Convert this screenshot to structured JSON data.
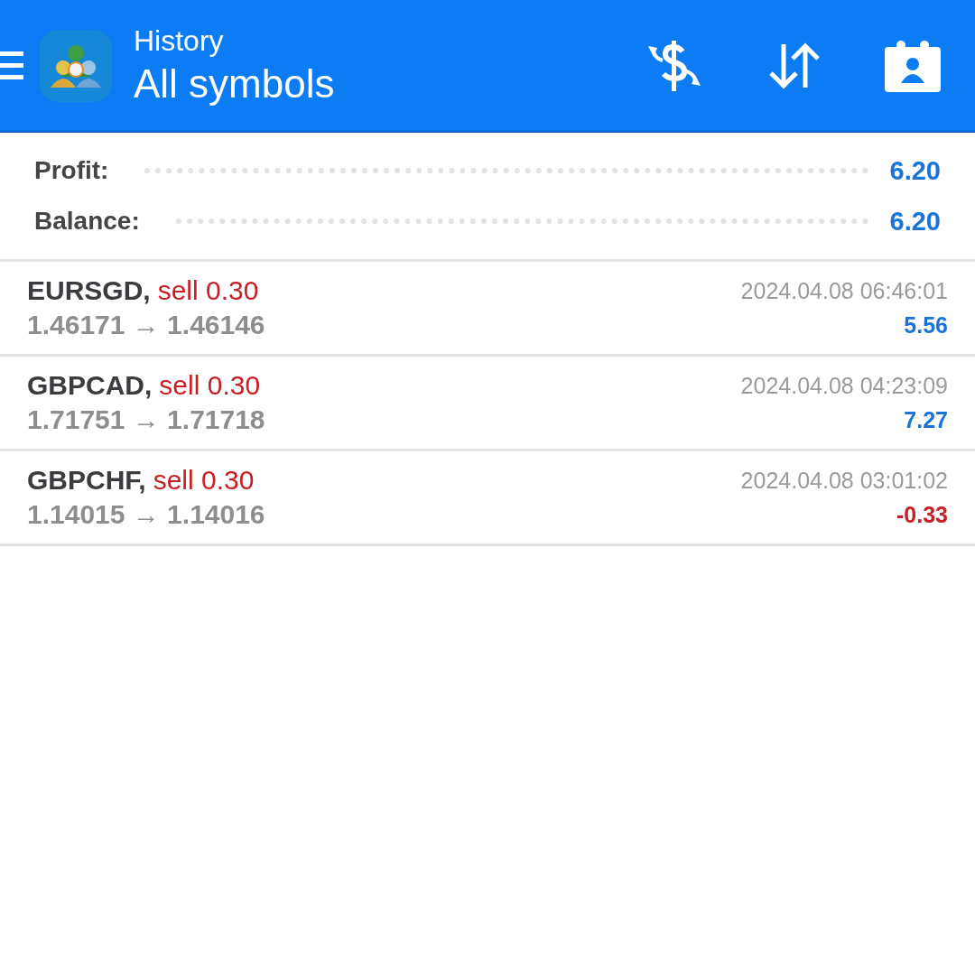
{
  "header": {
    "title": "History",
    "subtitle": "All symbols"
  },
  "summary": [
    {
      "label": "Profit:",
      "value": "6.20"
    },
    {
      "label": "Balance:",
      "value": "6.20"
    }
  ],
  "deals": [
    {
      "symbol": "EURSGD,",
      "order": "sell 0.30",
      "prices": "1.46171 → 1.46146",
      "time": "2024.04.08 06:46:01",
      "profit": "5.56",
      "color": "#1a73d9"
    },
    {
      "symbol": "GBPCAD,",
      "order": "sell 0.30",
      "prices": "1.71751 → 1.71718",
      "time": "2024.04.08 04:23:09",
      "profit": "7.27",
      "color": "#1a73d9"
    },
    {
      "symbol": "GBPCHF,",
      "order": "sell 0.30",
      "prices": "1.14015 → 1.14016",
      "time": "2024.04.08 03:01:02",
      "profit": "-0.33",
      "color": "#c62026"
    }
  ]
}
